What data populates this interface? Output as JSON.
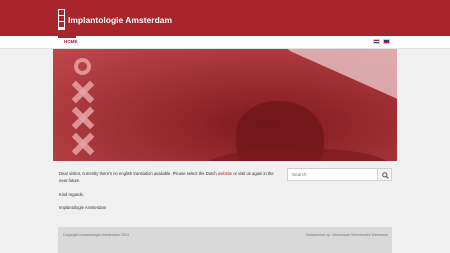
{
  "header": {
    "brand": "Implantologie Amsterdam",
    "logo_icon": "amsterdam-xxx-logo-icon",
    "color": "#a8252b"
  },
  "nav": {
    "home": "HOME",
    "languages": [
      {
        "code": "nl",
        "icon": "flag-nl-icon"
      },
      {
        "code": "en",
        "icon": "flag-uk-icon"
      }
    ]
  },
  "hero": {
    "emblem": "amsterdam-coat-of-arms-crosses"
  },
  "content": {
    "notice_before": "Dear visitor, currently there's no english translation available. Please select the Dutch ",
    "notice_link": "website",
    "notice_after": " or visit us again in the near future.",
    "regards": "Kind regards,",
    "signature": "Implantologie Amsterdam"
  },
  "search": {
    "placeholder": "Search",
    "icon": "search-icon"
  },
  "footer": {
    "copyright": "Copyright Implantologie Amsterdam 2014",
    "credit": "Gebasseerd op: Verbouwde Weerbericht Wireframe"
  }
}
